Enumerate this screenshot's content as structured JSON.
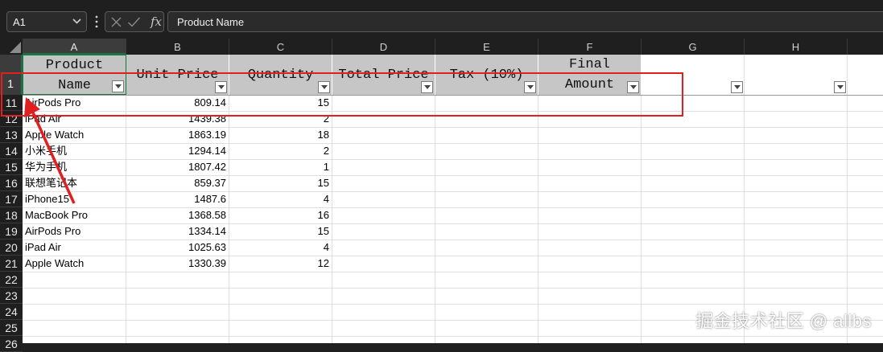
{
  "formula_bar": {
    "name_box": "A1",
    "fx_label": "fx",
    "content": "Product Name"
  },
  "columns": [
    "A",
    "B",
    "C",
    "D",
    "E",
    "F",
    "G",
    "H"
  ],
  "row_numbers": [
    "1",
    "11",
    "12",
    "13",
    "14",
    "15",
    "16",
    "17",
    "18",
    "19",
    "20",
    "21",
    "22",
    "23",
    "24",
    "25",
    "26"
  ],
  "header_row": [
    "Product Name",
    "Unit Price",
    "Quantity",
    "Total Price",
    "Tax (10%)",
    "Final Amount",
    "",
    ""
  ],
  "header_lines": {
    "a1_line1": "Product",
    "a1_line2": "Name",
    "f1_line1": "Final",
    "f1_line2": "Amount"
  },
  "data_rows": [
    {
      "product": "AirPods Pro",
      "price": "809.14",
      "qty": "15"
    },
    {
      "product": "iPad Air",
      "price": "1439.38",
      "qty": "2"
    },
    {
      "product": "Apple Watch",
      "price": "1863.19",
      "qty": "18"
    },
    {
      "product": "小米手机",
      "price": "1294.14",
      "qty": "2"
    },
    {
      "product": "华为手机",
      "price": "1807.42",
      "qty": "1"
    },
    {
      "product": "联想笔记本",
      "price": "859.37",
      "qty": "15"
    },
    {
      "product": "iPhone15",
      "price": "1487.6",
      "qty": "4"
    },
    {
      "product": "MacBook Pro",
      "price": "1368.58",
      "qty": "16"
    },
    {
      "product": "AirPods Pro",
      "price": "1334.14",
      "qty": "15"
    },
    {
      "product": "iPad Air",
      "price": "1025.63",
      "qty": "4"
    },
    {
      "product": "Apple Watch",
      "price": "1330.39",
      "qty": "12"
    }
  ],
  "icons": {
    "name_box_dropdown": "chevron-down-icon",
    "more": "vertical-dots-icon",
    "cancel": "close-icon",
    "enter": "check-icon",
    "filter": "filter-dropdown-icon"
  },
  "colors": {
    "selection_accent": "#1a7343",
    "annotation": "#e02020",
    "header_fill": "#c6c6c6"
  },
  "watermark": "掘金技术社区 @ allbs"
}
